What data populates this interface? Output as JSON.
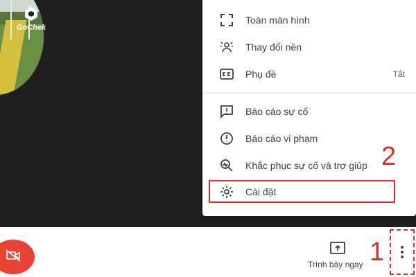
{
  "branding": {
    "logo_text": "GoChek"
  },
  "menu": {
    "items": [
      {
        "label": "Toàn màn hình",
        "icon": "fullscreen-icon",
        "trailing": ""
      },
      {
        "label": "Thay đổi nền",
        "icon": "change-background-icon",
        "trailing": ""
      },
      {
        "label": "Phụ đề",
        "icon": "captions-icon",
        "trailing": "Tắt"
      },
      {
        "label": "Báo cáo sự cố",
        "icon": "report-problem-icon",
        "trailing": ""
      },
      {
        "label": "Báo cáo vi phạm",
        "icon": "report-abuse-icon",
        "trailing": ""
      },
      {
        "label": "Khắc phục sự cố và trợ giúp",
        "icon": "troubleshoot-icon",
        "trailing": ""
      },
      {
        "label": "Cài đặt",
        "icon": "settings-icon",
        "trailing": ""
      }
    ]
  },
  "annotations": {
    "step1": "1",
    "step2": "2",
    "color": "#d93025"
  },
  "bottom_bar": {
    "camera_icon": "camera-off-icon",
    "present_label": "Trình bày ngay",
    "present_icon": "present-screen-icon",
    "more_icon": "more-vert-icon"
  },
  "colors": {
    "camera_off": "#ea4335",
    "menu_text": "#3c4043",
    "stage": "#1e1e1e"
  }
}
